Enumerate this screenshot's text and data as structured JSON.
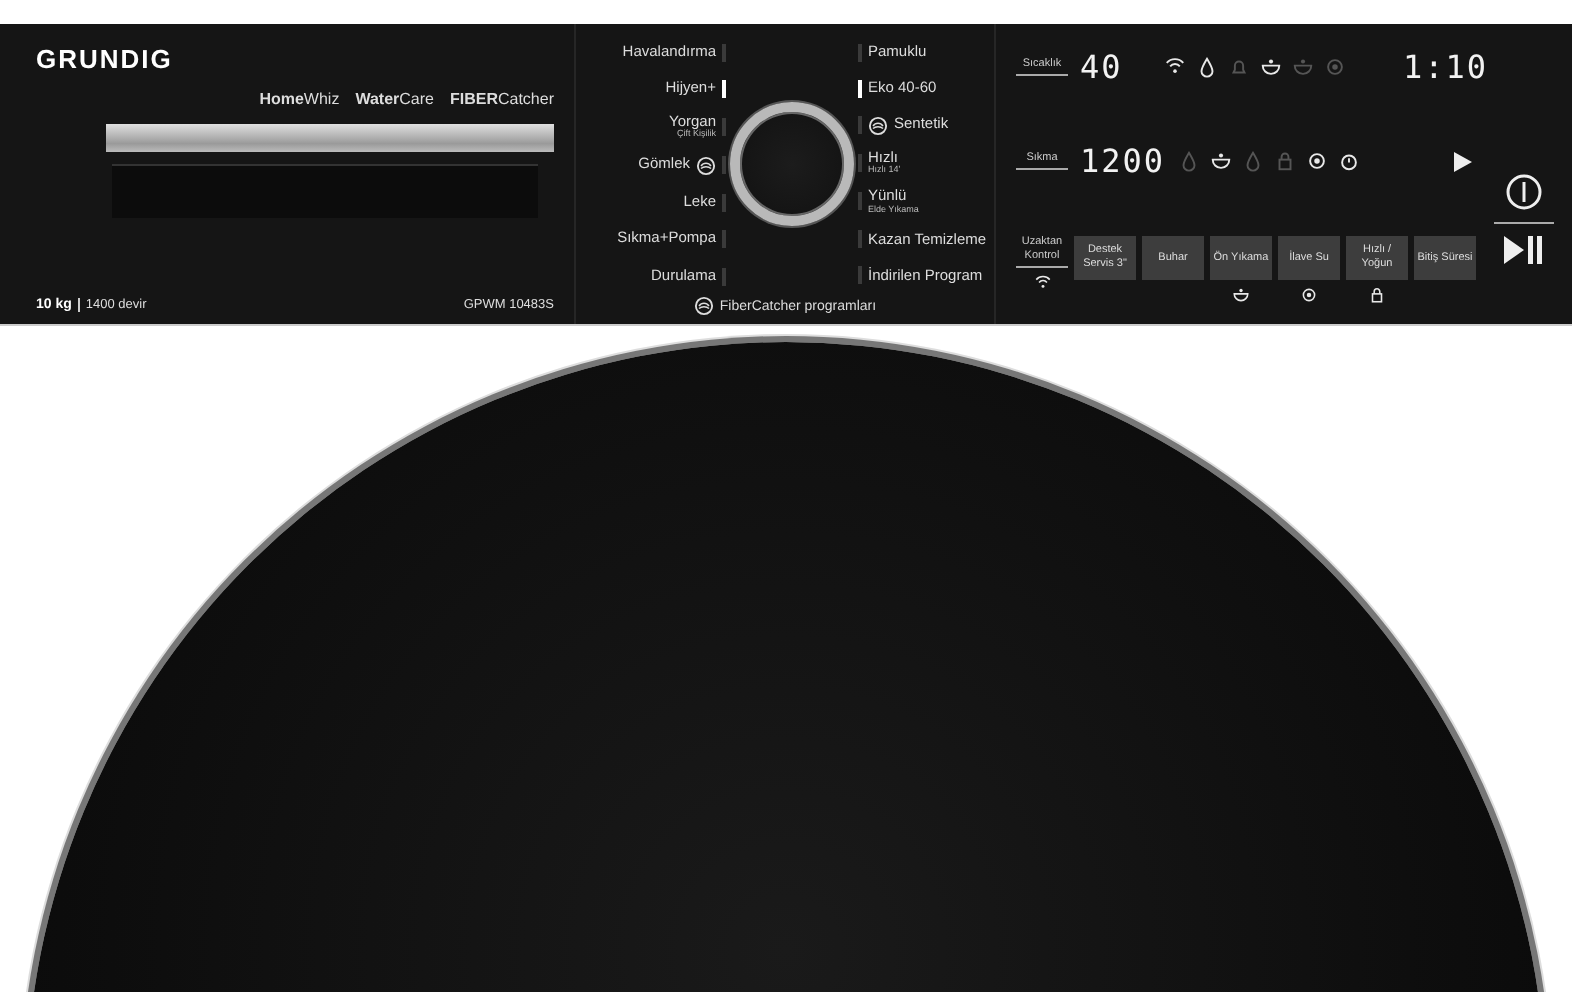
{
  "brand": {
    "name": "GRUNDIG",
    "features": [
      "**Home**Whiz",
      "**Water**Care",
      "**FIBER**Catcher"
    ],
    "capacity": "10 kg",
    "speed": "1400 devir",
    "model": "GPWM 10483S"
  },
  "programs_left": [
    {
      "label": "Havalandırma",
      "selected": false,
      "fibercatcher": false
    },
    {
      "label": "Hijyen+",
      "selected": true,
      "fibercatcher": false
    },
    {
      "label": "Yorgan",
      "sub": "Çift Kişilik",
      "selected": false,
      "fibercatcher": false
    },
    {
      "label": "Gömlek",
      "selected": false,
      "fibercatcher": true
    },
    {
      "label": "Leke",
      "selected": false,
      "fibercatcher": false
    },
    {
      "label": "Sıkma+Pompa",
      "selected": false,
      "fibercatcher": false
    },
    {
      "label": "Durulama",
      "selected": false,
      "fibercatcher": false
    }
  ],
  "programs_right": [
    {
      "label": "Pamuklu",
      "selected": false,
      "fibercatcher": false
    },
    {
      "label": "Eko 40-60",
      "selected": true,
      "fibercatcher": false
    },
    {
      "label": "Sentetik",
      "selected": false,
      "fibercatcher": true
    },
    {
      "label": "Hızlı",
      "sub": "Hızlı 14'",
      "selected": false,
      "fibercatcher": false
    },
    {
      "label": "Yünlü",
      "sub": "Elde Yıkama",
      "selected": false,
      "fibercatcher": false
    },
    {
      "label": "Kazan Temizleme",
      "selected": false,
      "fibercatcher": false
    },
    {
      "label": "İndirilen Program",
      "selected": false,
      "fibercatcher": false
    }
  ],
  "dial_legend": "FiberCatcher programları",
  "display": {
    "temperature_label": "Sıcaklık",
    "temperature": "40",
    "spin_label": "Sıkma",
    "spin": "1200",
    "time": "1:10",
    "remote_label": "Uzaktan Kontrol",
    "indicators_top": [
      {
        "kind": "wifi",
        "on": true
      },
      {
        "kind": "drop",
        "on": true
      },
      {
        "kind": "bell",
        "on": false
      },
      {
        "kind": "basin",
        "on": true
      },
      {
        "kind": "basin",
        "on": false
      },
      {
        "kind": "gear",
        "on": false
      }
    ],
    "indicators_bottom": [
      {
        "kind": "drop",
        "on": false
      },
      {
        "kind": "basin",
        "on": true
      },
      {
        "kind": "drop",
        "on": false
      },
      {
        "kind": "lock",
        "on": false
      },
      {
        "kind": "gear",
        "on": true
      },
      {
        "kind": "timer",
        "on": true
      }
    ],
    "options": [
      {
        "label": "Destek Servis 3\""
      },
      {
        "label": "Buhar"
      },
      {
        "label": "Ön Yıkama",
        "kind": "basin"
      },
      {
        "label": "İlave Su",
        "kind": "gear"
      },
      {
        "label": "Hızlı / Yoğun",
        "kind": "lock"
      },
      {
        "label": "Bitiş Süresi"
      }
    ]
  }
}
